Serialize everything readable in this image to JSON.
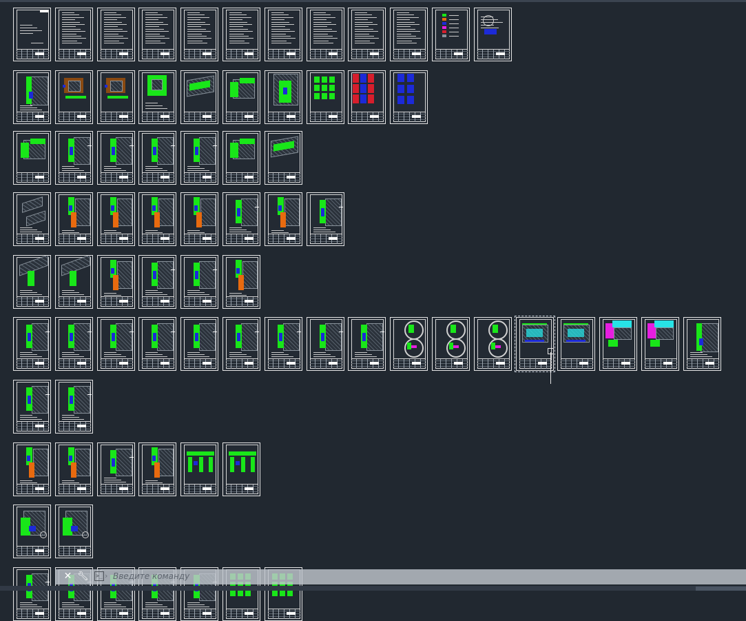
{
  "command_line": {
    "placeholder": "Введите команду",
    "close_icon": "close-icon",
    "settings_icon": "wrench-icon",
    "prompt_icon": "command-prompt-icon",
    "prompt_arrow": "›"
  },
  "colors": {
    "background": "#212830",
    "sheet_border": "#e6e6e6",
    "green": "#19e619",
    "blue": "#1c2ad8",
    "orange": "#e86a0f",
    "red": "#d61e2c",
    "magenta": "#e61ee0",
    "cyan": "#27e3e6"
  },
  "layout_rows": [
    {
      "row": 1,
      "sheets": 12,
      "content": [
        "title",
        "text",
        "text",
        "text",
        "text",
        "text",
        "text",
        "text",
        "text",
        "text",
        "legend",
        "plan"
      ]
    },
    {
      "row": 2,
      "sheets": 10,
      "content": [
        "green-detail",
        "brown-box",
        "brown-box",
        "green-grid",
        "iso-wall",
        "iso-corner",
        "green-arch",
        "green-panels",
        "red-panels",
        "blue-panels"
      ]
    },
    {
      "row": 3,
      "sheets": 7,
      "content": [
        "iso-corner",
        "section",
        "section",
        "section",
        "section",
        "iso-corner",
        "iso-wall"
      ]
    },
    {
      "row": 4,
      "sheets": 8,
      "content": [
        "iso-detail",
        "orange-section",
        "orange-section",
        "orange-section",
        "orange-section",
        "section",
        "orange-section",
        "section"
      ]
    },
    {
      "row": 5,
      "sheets": 6,
      "content": [
        "stair-iso",
        "stair-iso",
        "orange-section",
        "section",
        "section",
        "orange-section"
      ]
    },
    {
      "row": 6,
      "sheets": 17,
      "content": [
        "section",
        "section",
        "section",
        "section",
        "section",
        "section",
        "section",
        "section",
        "section",
        "circle-detail",
        "circle-detail",
        "circle-detail",
        "window-detail",
        "window-detail",
        "magenta-iso",
        "magenta-iso",
        "green-detail"
      ]
    },
    {
      "row": 7,
      "sheets": 2,
      "content": [
        "section",
        "section"
      ]
    },
    {
      "row": 8,
      "sheets": 6,
      "content": [
        "orange-section",
        "orange-section",
        "section",
        "orange-section",
        "green-frame",
        "green-frame"
      ]
    },
    {
      "row": 9,
      "sheets": 2,
      "content": [
        "corner-detail",
        "corner-detail"
      ]
    },
    {
      "row": 10,
      "sheets": 7,
      "content": [
        "section",
        "section",
        "section",
        "section",
        "section",
        "green-panels",
        "green-panels"
      ]
    }
  ]
}
